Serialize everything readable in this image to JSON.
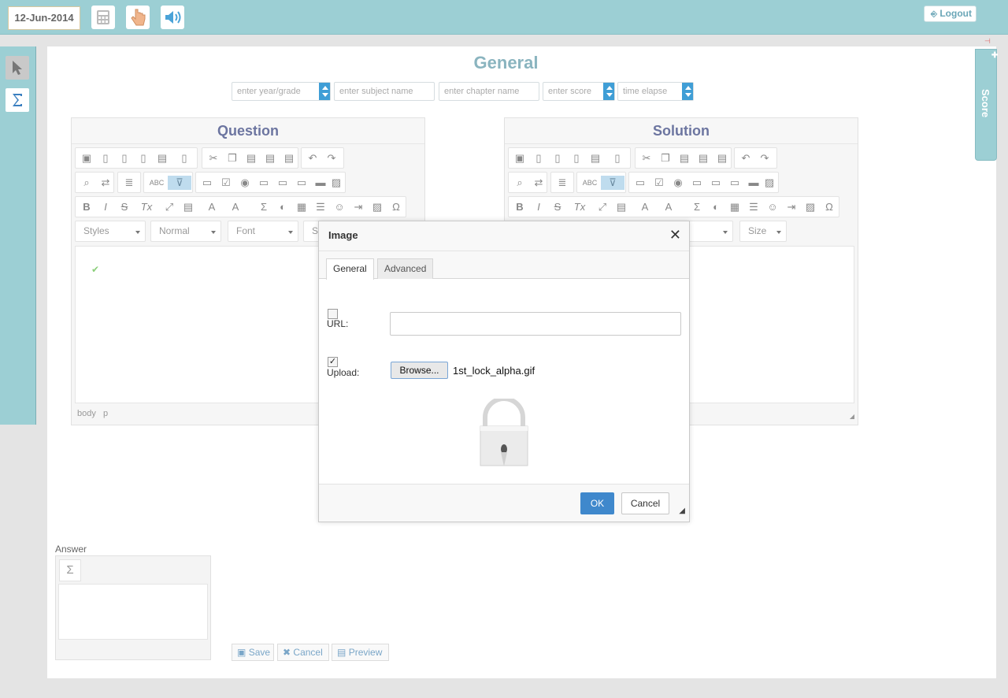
{
  "topbar": {
    "date": "12-Jun-2014",
    "icons": [
      "calculator-icon",
      "hand-pointer-icon",
      "speaker-icon"
    ],
    "logout_label": "Logout"
  },
  "sidebar": {
    "tools": [
      "pointer-icon",
      "sigma-icon"
    ]
  },
  "page": {
    "title": "General",
    "fields": [
      {
        "placeholder": "enter year/grade"
      },
      {
        "placeholder": "enter subject name"
      },
      {
        "placeholder": "enter chapter name"
      },
      {
        "placeholder": "enter score"
      },
      {
        "placeholder": "time elapse"
      }
    ]
  },
  "question_editor": {
    "title": "Question",
    "styles": "Styles",
    "format": "Normal",
    "font": "Font",
    "size": "S",
    "path": [
      "body",
      "p"
    ]
  },
  "solution_editor": {
    "title": "Solution",
    "size": "Size"
  },
  "score_tab": "Score",
  "answer": {
    "label": "Answer"
  },
  "actions": {
    "save": "Save",
    "cancel": "Cancel",
    "preview": "Preview"
  },
  "dialog": {
    "title": "Image",
    "close": "✕",
    "tabs": [
      "General",
      "Advanced"
    ],
    "url_label": "URL:",
    "url_checked": false,
    "upload_label": "Upload:",
    "upload_checked": true,
    "browse_label": "Browse...",
    "file_name": "1st_lock_alpha.gif",
    "ok_label": "OK",
    "cancel_label": "Cancel"
  },
  "colors": {
    "topbar": "#9ccfd4",
    "accent_blue": "#3f88cc",
    "title_teal": "#8ab4bf",
    "editor_title": "#6c75a0"
  }
}
